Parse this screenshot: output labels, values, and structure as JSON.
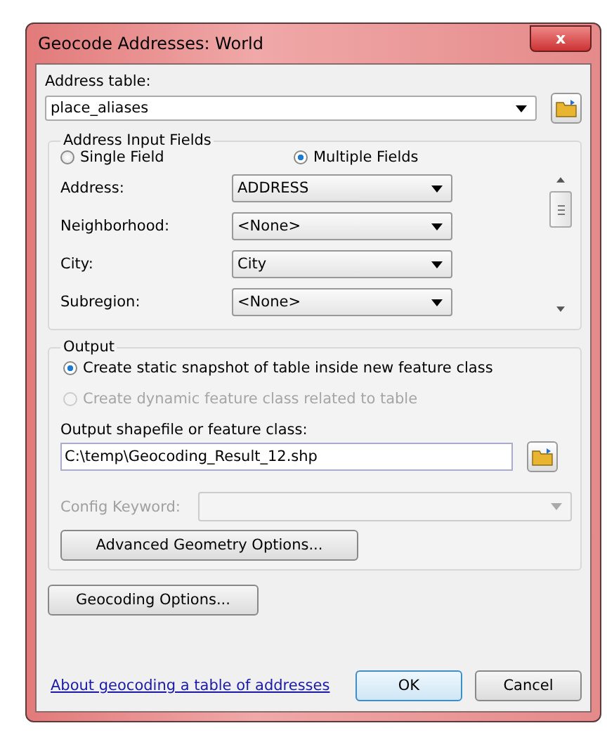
{
  "window": {
    "title": "Geocode Addresses:  World",
    "close": "x"
  },
  "address_table": {
    "label": "Address table:",
    "value": "place_aliases"
  },
  "input_fields": {
    "title": "Address Input Fields",
    "modes": [
      {
        "label": "Single Field",
        "selected": false
      },
      {
        "label": "Multiple Fields",
        "selected": true
      }
    ],
    "rows": [
      {
        "label": "Address:",
        "value": "ADDRESS"
      },
      {
        "label": "Neighborhood:",
        "value": "<None>"
      },
      {
        "label": "City:",
        "value": "City"
      },
      {
        "label": "Subregion:",
        "value": "<None>"
      }
    ]
  },
  "output": {
    "title": "Output",
    "options": [
      {
        "label": "Create static snapshot of table inside new feature class",
        "selected": true,
        "disabled": false
      },
      {
        "label": "Create dynamic feature class related to table",
        "selected": false,
        "disabled": true
      }
    ],
    "path_label": "Output shapefile or feature class:",
    "path_value": "C:\\temp\\Geocoding_Result_12.shp",
    "config_label": "Config Keyword:",
    "config_disabled": true,
    "advanced_button": "Advanced Geometry Options..."
  },
  "geocoding_options_button": "Geocoding Options...",
  "footer": {
    "link": "About geocoding a table of addresses",
    "buttons": [
      "OK",
      "Cancel"
    ]
  }
}
